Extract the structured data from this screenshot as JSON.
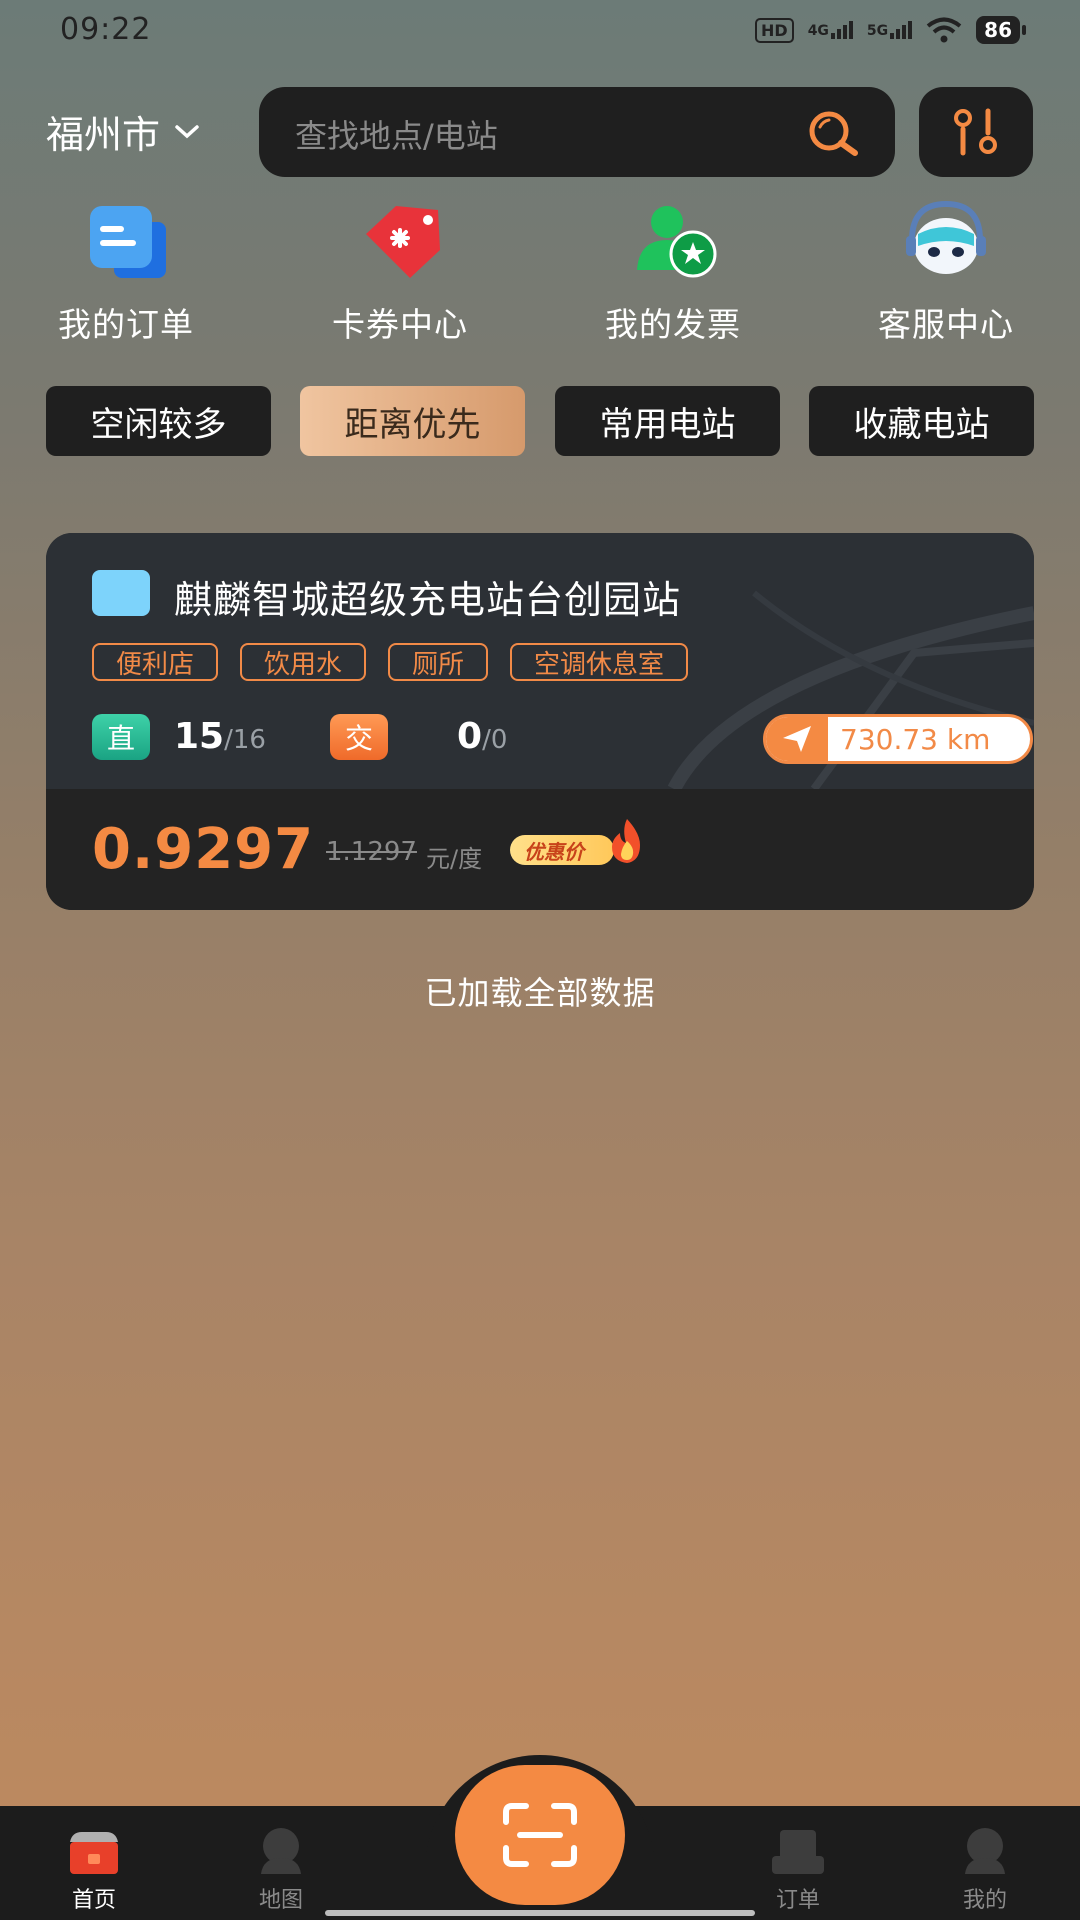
{
  "status_bar": {
    "time": "09:22",
    "hd_label": "HD",
    "net1": "4G",
    "net2": "5G",
    "battery": "86"
  },
  "header": {
    "city": "福州市",
    "search_placeholder": "查找地点/电站"
  },
  "quick_menu": [
    {
      "label": "我的订单",
      "icon": "order-icon"
    },
    {
      "label": "卡券中心",
      "icon": "coupon-icon"
    },
    {
      "label": "我的发票",
      "icon": "invoice-icon"
    },
    {
      "label": "客服中心",
      "icon": "customer-service-icon"
    }
  ],
  "tabs": [
    {
      "label": "空闲较多",
      "active": false
    },
    {
      "label": "距离优先",
      "active": true
    },
    {
      "label": "常用电站",
      "active": false
    },
    {
      "label": "收藏电站",
      "active": false
    }
  ],
  "station": {
    "name": "麒麟智城超级充电站台创园站",
    "amenities": [
      "便利店",
      "饮用水",
      "厕所",
      "空调休息室"
    ],
    "dc_label": "直",
    "dc_available": "15",
    "dc_total": "/16",
    "ac_label": "交",
    "ac_available": "0",
    "ac_total": "/0",
    "distance": "730.73 km",
    "price": "0.9297",
    "original_price": "1.1297",
    "price_unit": "元/度",
    "promo_label": "优惠价"
  },
  "list_footer": "已加载全部数据",
  "bottom_nav": {
    "items": [
      {
        "label": "首页",
        "active": true
      },
      {
        "label": "地图",
        "active": false
      },
      {
        "label": "订单",
        "active": false
      },
      {
        "label": "我的",
        "active": false
      }
    ]
  },
  "colors": {
    "accent": "#f48a43",
    "dark_surface": "#1f1f1f",
    "dc_green": "#1aa383",
    "tag_orange": "#f28a47"
  }
}
